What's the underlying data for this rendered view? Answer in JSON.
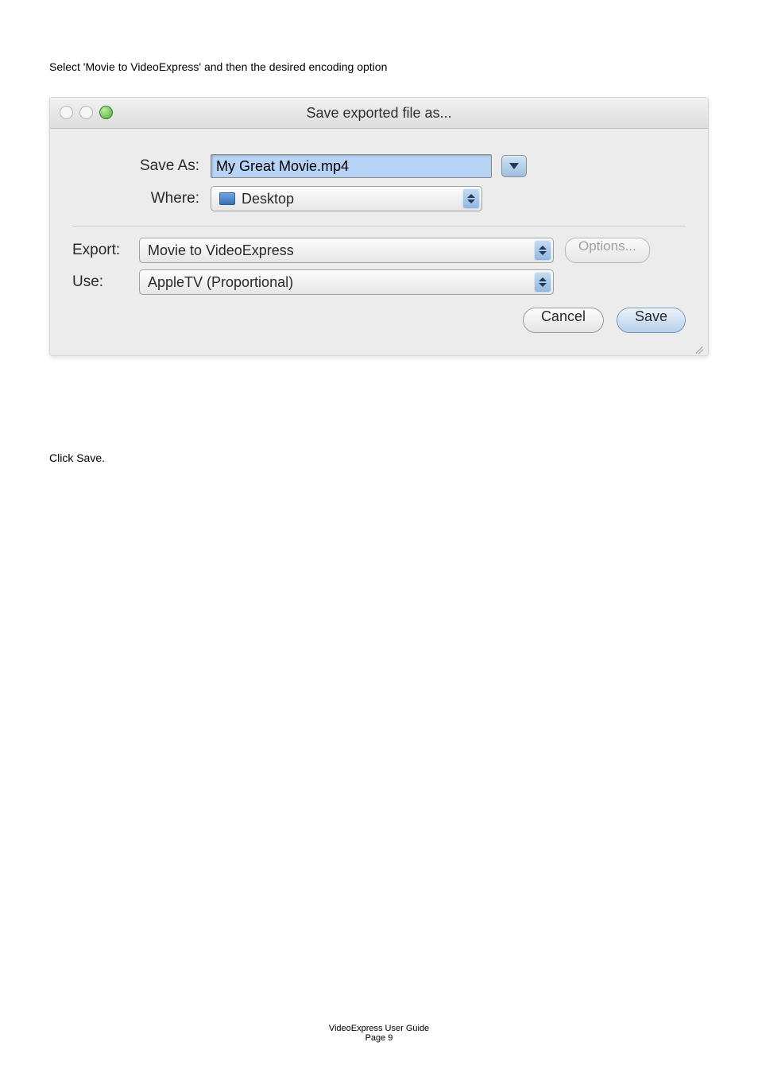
{
  "instruction_1": "Select 'Movie to VideoExpress' and then the desired encoding option",
  "instruction_2": "Click Save.",
  "dialog": {
    "title": "Save exported file as...",
    "save_as_label": "Save As:",
    "save_as_value": "My Great Movie.mp4",
    "where_label": "Where:",
    "where_value": "Desktop",
    "export_label": "Export:",
    "export_value": "Movie to VideoExpress",
    "options_label": "Options...",
    "use_label": "Use:",
    "use_value": "AppleTV (Proportional)",
    "cancel": "Cancel",
    "save": "Save"
  },
  "footer": {
    "title": "VideoExpress User Guide",
    "page": "Page 9"
  }
}
